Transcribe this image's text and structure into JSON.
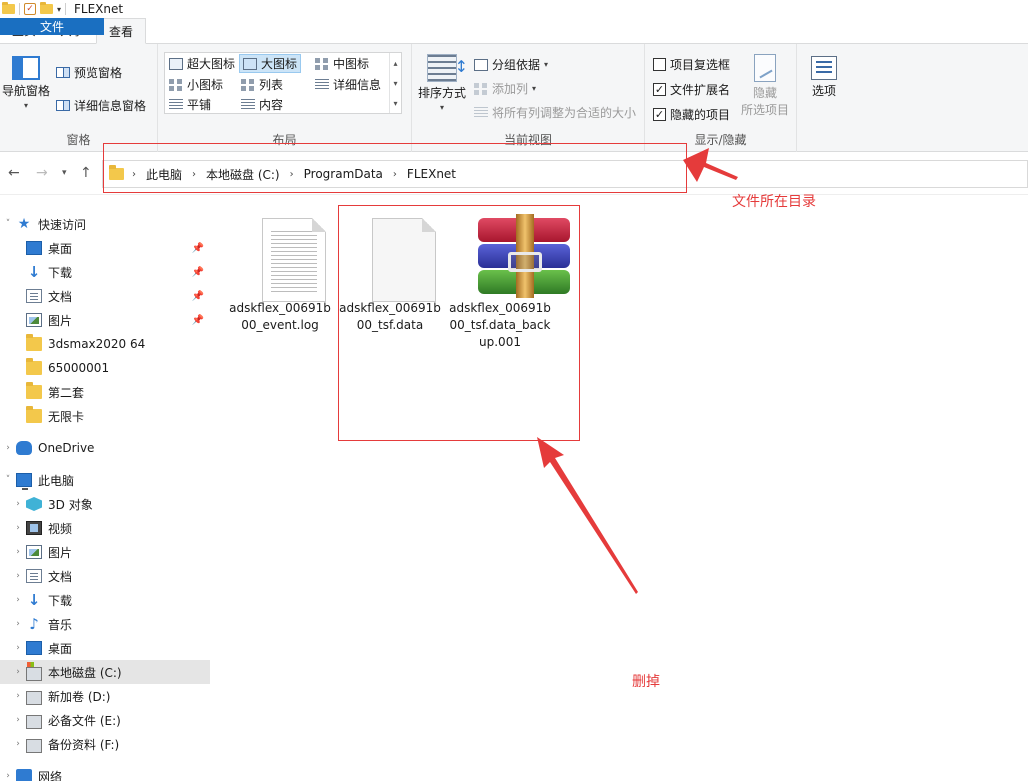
{
  "window": {
    "title": "FLEXnet"
  },
  "tabs": [
    {
      "label": "文件"
    },
    {
      "label": "主页"
    },
    {
      "label": "共享"
    },
    {
      "label": "查看"
    }
  ],
  "ribbon": {
    "panes": {
      "nav_pane": "导航窗格",
      "preview_pane": "预览窗格",
      "details_pane": "详细信息窗格",
      "label": "窗格"
    },
    "layout": {
      "extra_large": "超大图标",
      "large": "大图标",
      "medium": "中图标",
      "small": "小图标",
      "list": "列表",
      "details": "详细信息",
      "tiles": "平铺",
      "content": "内容",
      "label": "布局"
    },
    "current_view": {
      "sort": "排序方式",
      "group": "分组依据",
      "add_column": "添加列",
      "fit_columns": "将所有列调整为合适的大小",
      "label": "当前视图"
    },
    "show_hide": {
      "item_checkboxes": "项目复选框",
      "file_ext": "文件扩展名",
      "hidden_items": "隐藏的项目",
      "hide_selected_1": "隐藏",
      "hide_selected_2": "所选项目",
      "label": "显示/隐藏",
      "item_checkboxes_checked": false,
      "file_ext_checked": true,
      "hidden_items_checked": true
    },
    "options": "选项"
  },
  "address": {
    "crumbs": [
      "此电脑",
      "本地磁盘 (C:)",
      "ProgramData",
      "FLEXnet"
    ]
  },
  "sidebar": {
    "quick_access": "快速访问",
    "quick_items": [
      "桌面",
      "下载",
      "文档",
      "图片",
      "3dsmax2020 64",
      "65000001",
      "第二套",
      "无限卡"
    ],
    "onedrive": "OneDrive",
    "this_pc": "此电脑",
    "pc_items": [
      "3D 对象",
      "视频",
      "图片",
      "文档",
      "下载",
      "音乐",
      "桌面",
      "本地磁盘 (C:)",
      "新加卷 (D:)",
      "必备文件 (E:)",
      "备份资料 (F:)"
    ],
    "network": "网络"
  },
  "files": [
    {
      "name": "adskflex_00691b00_event.log",
      "type": "log"
    },
    {
      "name": "adskflex_00691b00_tsf.data",
      "type": "data"
    },
    {
      "name": "adskflex_00691b00_tsf.data_backup.001",
      "type": "archive"
    }
  ],
  "annotations": {
    "dir_note": "文件所在目录",
    "delete_note": "删掉",
    "color": "#e53b3b"
  },
  "colors": {
    "file_tab": "#1a6fc1",
    "accent": "#2f7bd1",
    "selected_bg": "#e5e5e5"
  }
}
